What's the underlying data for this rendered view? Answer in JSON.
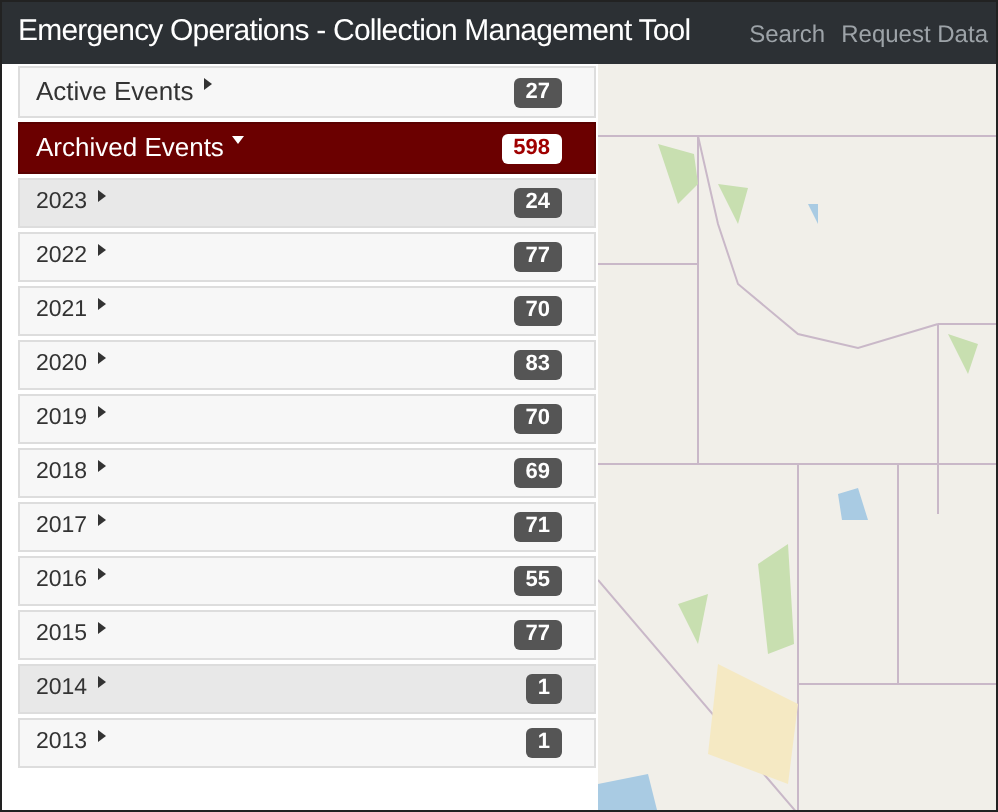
{
  "header": {
    "title": "Emergency Operations - Collection Management Tool",
    "nav": [
      {
        "label": "Search"
      },
      {
        "label": "Request Data"
      }
    ]
  },
  "sidebar": {
    "items": [
      {
        "label": "Active Events",
        "count": "27",
        "expanded": false
      },
      {
        "label": "Archived Events",
        "count": "598",
        "expanded": true,
        "children": [
          {
            "label": "2023",
            "count": "24",
            "highlighted": true
          },
          {
            "label": "2022",
            "count": "77",
            "highlighted": false
          },
          {
            "label": "2021",
            "count": "70",
            "highlighted": false
          },
          {
            "label": "2020",
            "count": "83",
            "highlighted": false
          },
          {
            "label": "2019",
            "count": "70",
            "highlighted": false
          },
          {
            "label": "2018",
            "count": "69",
            "highlighted": false
          },
          {
            "label": "2017",
            "count": "71",
            "highlighted": false
          },
          {
            "label": "2016",
            "count": "55",
            "highlighted": false
          },
          {
            "label": "2015",
            "count": "77",
            "highlighted": false
          },
          {
            "label": "2014",
            "count": "1",
            "highlighted": true
          },
          {
            "label": "2013",
            "count": "1",
            "highlighted": false
          }
        ]
      }
    ]
  }
}
